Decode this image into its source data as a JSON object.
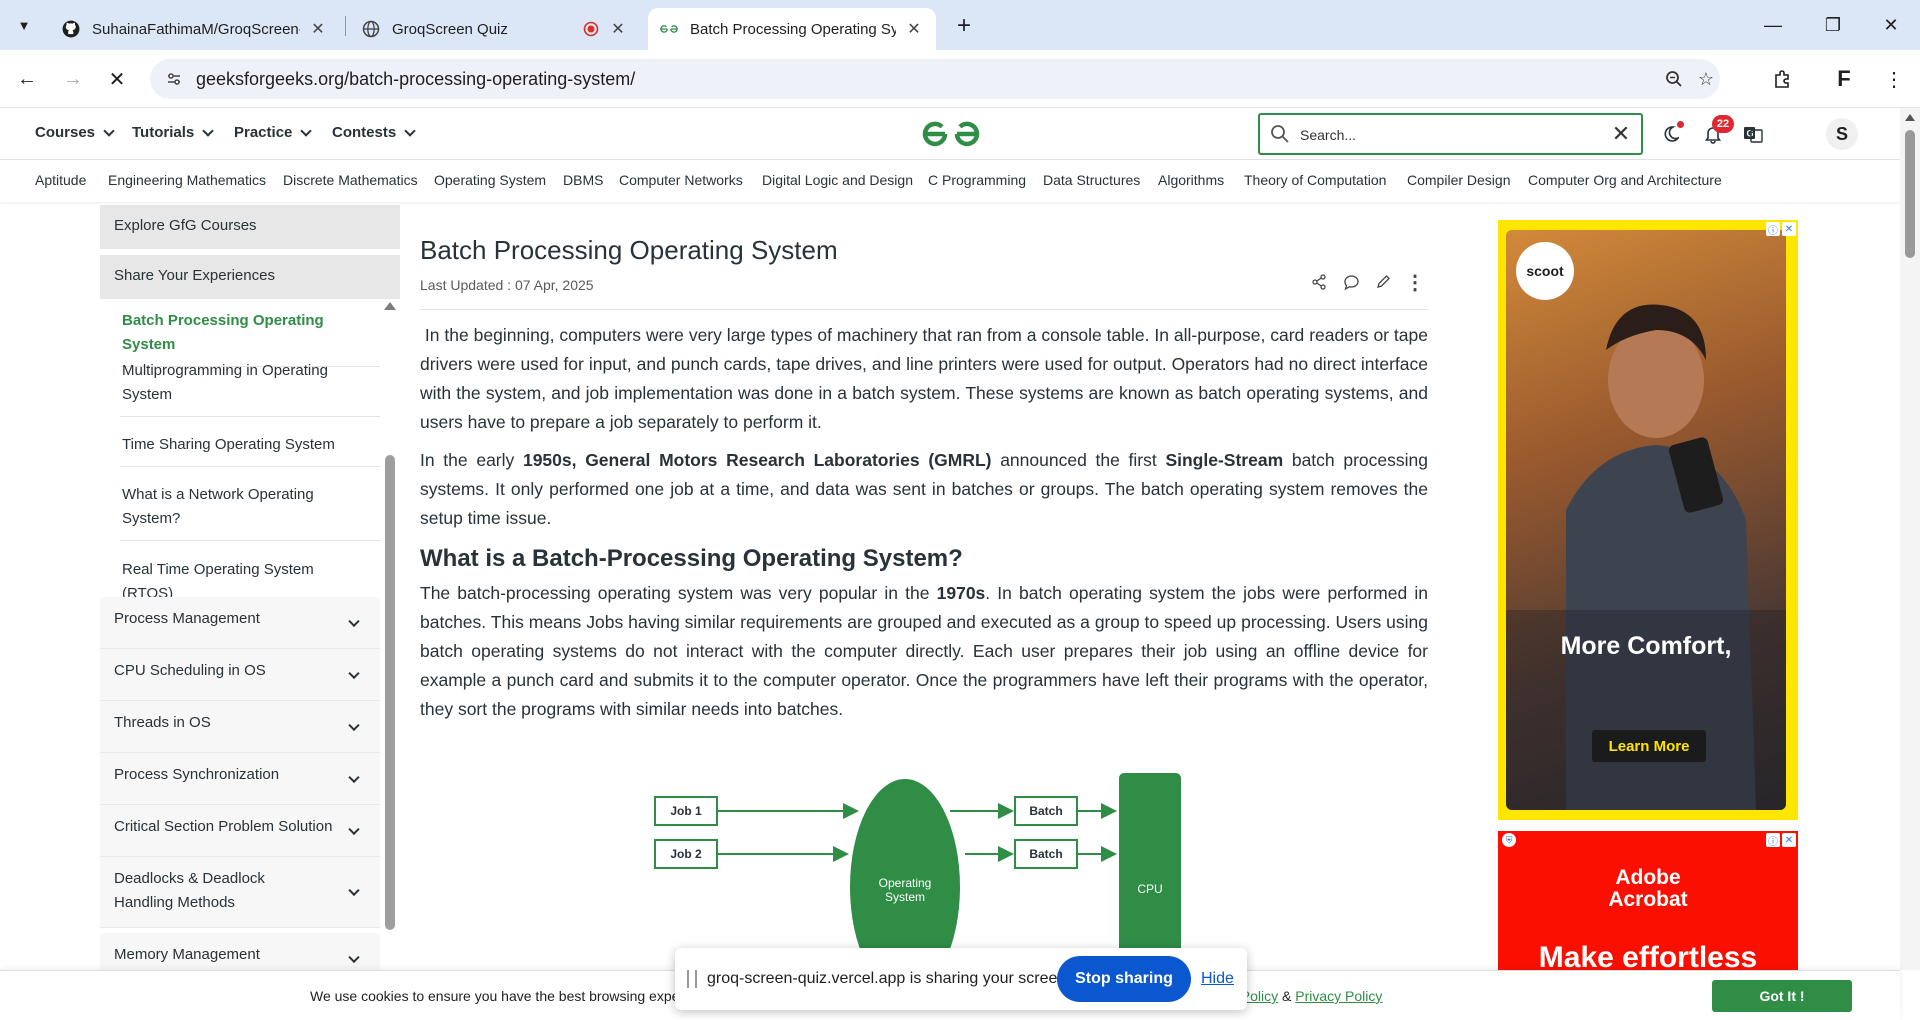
{
  "browser": {
    "tabs": [
      {
        "title": "SuhainaFathimaM/GroqScreen-Q",
        "favicon": "github-icon"
      },
      {
        "title": "GroqScreen Quiz",
        "favicon": "globe-icon"
      },
      {
        "title": "Batch Processing Operating Sys",
        "favicon": "gfg-icon"
      }
    ],
    "url": "geeksforgeeks.org/batch-processing-operating-system/",
    "profile_letter": "F"
  },
  "header": {
    "menu": [
      "Courses",
      "Tutorials",
      "Practice",
      "Contests"
    ],
    "search_placeholder": "Search...",
    "notification_count": "22",
    "avatar_letter": "S"
  },
  "subnav": [
    "Aptitude",
    "Engineering Mathematics",
    "Discrete Mathematics",
    "Operating System",
    "DBMS",
    "Computer Networks",
    "Digital Logic and Design",
    "C Programming",
    "Data Structures",
    "Algorithms",
    "Theory of Computation",
    "Compiler Design",
    "Computer Org and Architecture"
  ],
  "sidebar": {
    "headers": [
      "Explore GfG Courses",
      "Share Your Experiences"
    ],
    "sub_items": [
      "Batch Processing Operating System",
      "Multiprogramming in Operating System",
      "Time Sharing Operating System",
      "What is a Network Operating System?",
      "Real Time Operating System (RTOS)"
    ],
    "sections": [
      "Process Management",
      "CPU Scheduling in OS",
      "Threads in OS",
      "Process Synchronization",
      "Critical Section Problem Solution",
      "Deadlocks & Deadlock Handling Methods",
      "Memory Management"
    ]
  },
  "article": {
    "title": "Batch Processing Operating System",
    "last_updated": "Last Updated : 07 Apr, 2025",
    "p1": "In the beginning, computers were very large types of machinery that ran from a console table. In all-purpose, card readers or tape drivers were used for input, and punch cards, tape drives, and line printers were used for output. Operators had no direct interface with the system, and job implementation was done in a batch system. These systems are known as batch operating systems, and users have to prepare a job separately to perform it.",
    "p2_a": "In the early ",
    "p2_b": "1950s, General Motors Research Laboratories (GMRL)",
    "p2_c": " announced the first ",
    "p2_d": "Single-Stream",
    "p2_e": " batch processing systems. It only performed one job at a time, and data was sent in batches or groups. The batch operating system removes the setup time issue.",
    "h2": "What is a Batch-Processing Operating System?",
    "p3_a": "The batch-processing operating system was very popular in the ",
    "p3_b": "1970s",
    "p3_c": ". In batch operating system the jobs were performed in batches. This means Jobs having similar requirements are grouped and executed as a group to speed up processing. Users using batch operating systems do not interact with the computer directly. Each user prepares their job using an offline device for example a punch card and submits it to the computer operator. Once the programmers have left their programs with the operator, they sort the programs with similar needs into batches."
  },
  "diagram": {
    "job1": "Job 1",
    "job2": "Job 2",
    "os_line1": "Operating",
    "os_line2": "System",
    "batch1": "Batch",
    "batch2": "Batch",
    "cpu": "CPU",
    "color": "#2f8d46"
  },
  "ads": {
    "ad1_logo": "scoot",
    "ad1_headline": "More Comfort,",
    "ad1_button": "Learn More",
    "ad2_brand_1": "Adobe",
    "ad2_brand_2": "Acrobat",
    "ad2_tagline": "Make effortless"
  },
  "cookie": {
    "text": "We use cookies to ensure you have the best browsing experience",
    "link_1": "ie Policy",
    "amp": " & ",
    "link_2": "Privacy Policy",
    "button": "Got It !"
  },
  "share": {
    "text": "groq-screen-quiz.vercel.app is sharing your screen.",
    "stop": "Stop sharing",
    "hide": "Hide"
  },
  "colors": {
    "gfg_green": "#2f8d46",
    "chrome_blue": "#0b57d0",
    "ad_yellow": "#ffe600",
    "adobe_red": "#fa0f00"
  }
}
